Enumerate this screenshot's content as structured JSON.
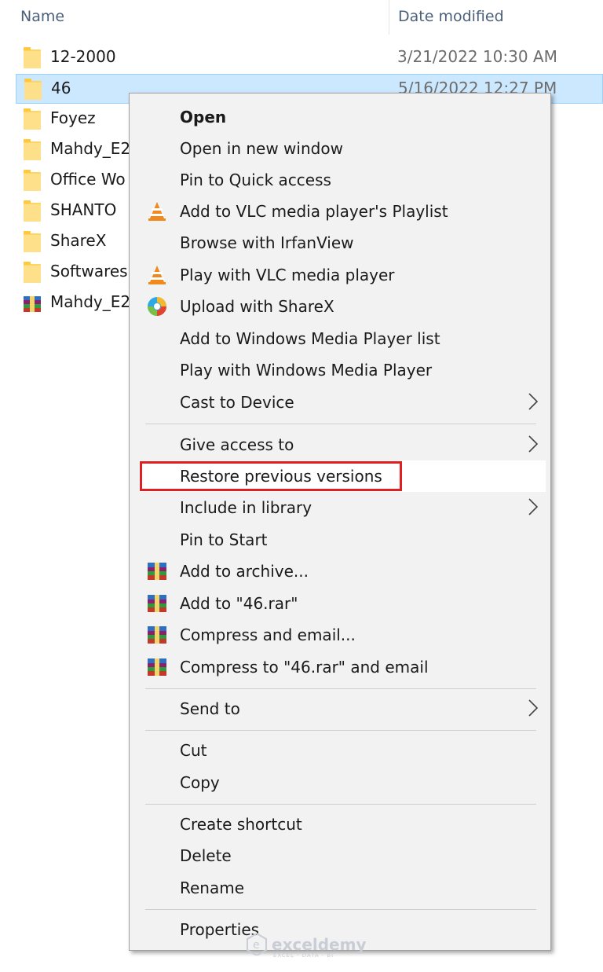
{
  "header": {
    "name_col": "Name",
    "date_col": "Date modified"
  },
  "files": [
    {
      "name": "12-2000",
      "date": "3/21/2022 10:30 AM",
      "type": "folder"
    },
    {
      "name": "46",
      "date": "5/16/2022 12:27 PM",
      "type": "folder",
      "selected": true
    },
    {
      "name": "Foyez",
      "date": "",
      "type": "folder"
    },
    {
      "name": "Mahdy_E2",
      "date": "",
      "type": "folder"
    },
    {
      "name": "Office Wo",
      "date": "",
      "type": "folder"
    },
    {
      "name": "SHANTO",
      "date": "",
      "type": "folder"
    },
    {
      "name": "ShareX",
      "date": "",
      "type": "folder"
    },
    {
      "name": "Softwares",
      "date": "",
      "type": "folder"
    },
    {
      "name": "Mahdy_E2",
      "date": "",
      "type": "rar-archive"
    }
  ],
  "menu": {
    "items": [
      {
        "label": "Open",
        "icon": ""
      },
      {
        "label": "Open in new window",
        "icon": ""
      },
      {
        "label": "Pin to Quick access",
        "icon": ""
      },
      {
        "label": "Add to VLC media player's Playlist",
        "icon": "vlc-icon"
      },
      {
        "label": "Browse with IrfanView",
        "icon": ""
      },
      {
        "label": "Play with VLC media player",
        "icon": "vlc-icon"
      },
      {
        "label": "Upload with ShareX",
        "icon": "sharex-icon"
      },
      {
        "label": "Add to Windows Media Player list",
        "icon": ""
      },
      {
        "label": "Play with Windows Media Player",
        "icon": ""
      },
      {
        "label": "Cast to Device",
        "icon": "",
        "submenu": true
      },
      {
        "label": "Give access to",
        "icon": "",
        "submenu": true
      },
      {
        "label": "Restore previous versions",
        "icon": "",
        "highlighted": true
      },
      {
        "label": "Include in library",
        "icon": "",
        "submenu": true
      },
      {
        "label": "Pin to Start",
        "icon": ""
      },
      {
        "label": "Add to archive...",
        "icon": "winrar-icon"
      },
      {
        "label": "Add to \"46.rar\"",
        "icon": "winrar-icon"
      },
      {
        "label": "Compress and email...",
        "icon": "winrar-icon"
      },
      {
        "label": "Compress to \"46.rar\" and email",
        "icon": "winrar-icon"
      },
      {
        "label": "Send to",
        "icon": "",
        "submenu": true
      },
      {
        "label": "Cut",
        "icon": ""
      },
      {
        "label": "Copy",
        "icon": ""
      },
      {
        "label": "Create shortcut",
        "icon": ""
      },
      {
        "label": "Delete",
        "icon": ""
      },
      {
        "label": "Rename",
        "icon": ""
      },
      {
        "label": "Properties",
        "icon": ""
      }
    ]
  },
  "watermark": {
    "text": "exceldemy",
    "sub": "EXCEL · DATA · BI"
  },
  "colors": {
    "selection": "#cce8ff",
    "highlight_border": "#e02020",
    "menu_bg": "#f2f2f2"
  }
}
